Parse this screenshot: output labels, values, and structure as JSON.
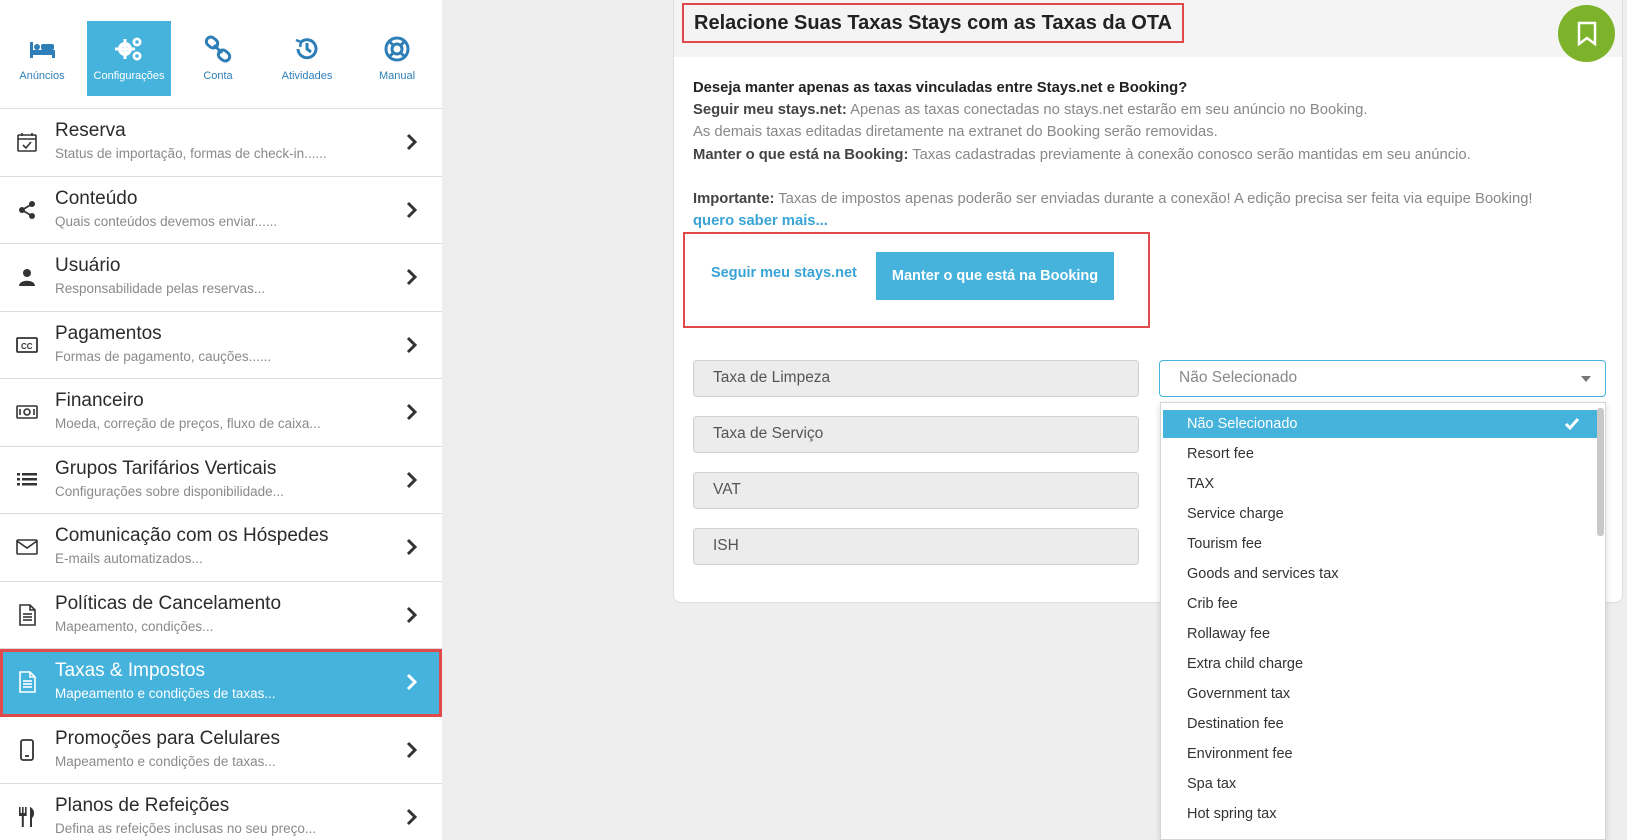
{
  "topnav": [
    {
      "label": "Anúncios",
      "icon": "bed-icon"
    },
    {
      "label": "Configurações",
      "icon": "gears-icon"
    },
    {
      "label": "Conta",
      "icon": "link-icon"
    },
    {
      "label": "Atividades",
      "icon": "history-icon"
    },
    {
      "label": "Manual",
      "icon": "lifebuoy-icon"
    }
  ],
  "menu": [
    {
      "title": "Reserva",
      "subtitle": "Status de importação, formas de check-in......",
      "icon": "calendar-check-icon"
    },
    {
      "title": "Conteúdo",
      "subtitle": "Quais conteúdos devemos enviar......",
      "icon": "share-icon"
    },
    {
      "title": "Usuário",
      "subtitle": "Responsabilidade pelas reservas...",
      "icon": "user-icon"
    },
    {
      "title": "Pagamentos",
      "subtitle": "Formas de pagamento, cauções......",
      "icon": "credit-card-icon"
    },
    {
      "title": "Financeiro",
      "subtitle": "Moeda, correção de preços, fluxo de caixa...",
      "icon": "money-icon"
    },
    {
      "title": "Grupos Tarifários Verticais",
      "subtitle": "Configurações sobre disponibilidade...",
      "icon": "list-icon"
    },
    {
      "title": "Comunicação com os Hóspedes",
      "subtitle": "E-mails automatizados...",
      "icon": "envelope-icon"
    },
    {
      "title": "Políticas de Cancelamento",
      "subtitle": "Mapeamento, condições...",
      "icon": "document-icon"
    },
    {
      "title": "Taxas & Impostos",
      "subtitle": "Mapeamento e condições de taxas...",
      "icon": "document-icon"
    },
    {
      "title": "Promoções para Celulares",
      "subtitle": "Mapeamento e condições de taxas...",
      "icon": "mobile-icon"
    },
    {
      "title": "Planos de Refeições",
      "subtitle": "Defina as refeições inclusas no seu preço...",
      "icon": "utensils-icon"
    }
  ],
  "panel": {
    "title": "Relacione Suas Taxas Stays com as Taxas da OTA",
    "question": "Deseja manter apenas as taxas vinculadas entre Stays.net e Booking?",
    "opt1_label": "Seguir meu stays.net:",
    "opt1_text": "Apenas as taxas conectadas no stays.net estarão em seu anúncio no Booking.",
    "opt1_text2": "As demais taxas editadas diretamente na extranet do Booking serão removidas.",
    "opt2_label": "Manter o que está na Booking:",
    "opt2_text": "Taxas cadastradas previamente à conexão conosco serão mantidas em seu anúncio.",
    "important_label": "Importante:",
    "important_text": "Taxas de impostos apenas poderão ser enviadas durante a conexão! A edição precisa ser feita via equipe Booking!",
    "more_link": "quero saber mais...",
    "btn_follow": "Seguir meu stays.net",
    "btn_keep": "Manter o que está na Booking"
  },
  "taxes": [
    "Taxa de Limpeza",
    "Taxa de Serviço",
    "VAT",
    "ISH"
  ],
  "select": {
    "value": "Não Selecionado",
    "options": [
      "Não Selecionado",
      "Resort fee",
      "TAX",
      "Service charge",
      "Tourism fee",
      "Goods and services tax",
      "Crib fee",
      "Rollaway fee",
      "Extra child charge",
      "Government tax",
      "Destination fee",
      "Environment fee",
      "Spa tax",
      "Hot spring tax"
    ]
  },
  "colors": {
    "accent": "#45b3dc",
    "highlight": "#e04a4a",
    "bookmark": "#7db32a"
  }
}
